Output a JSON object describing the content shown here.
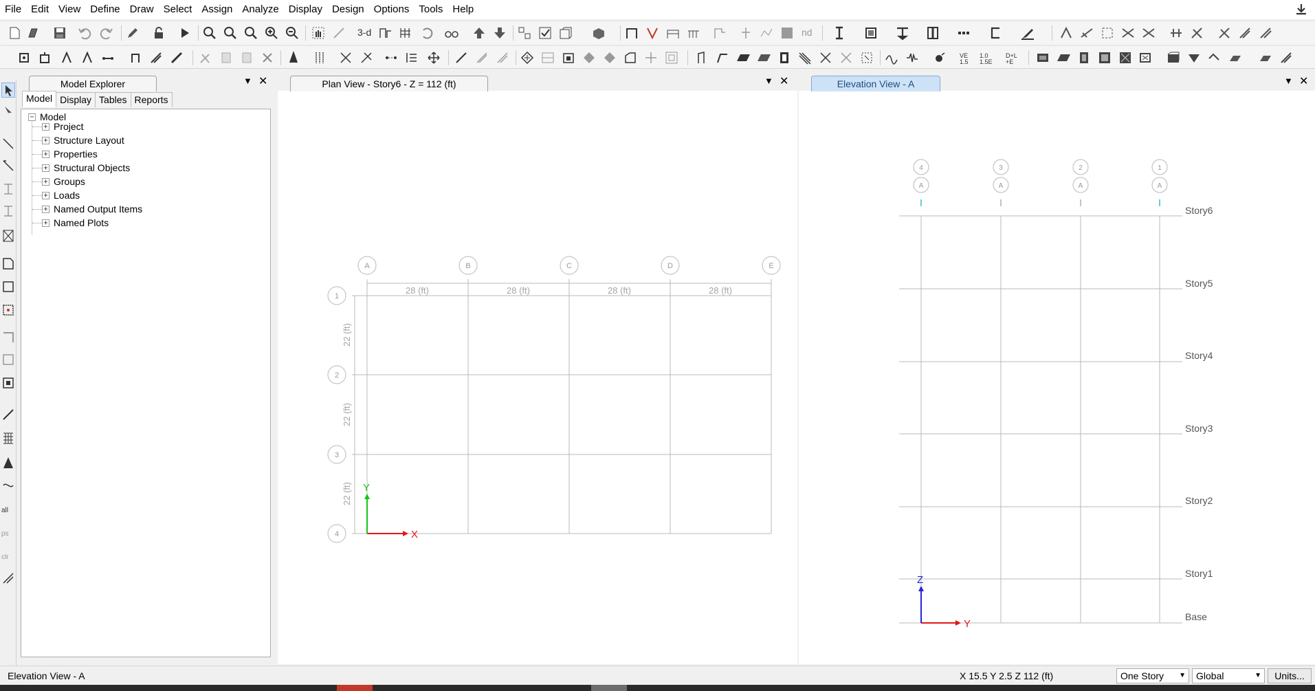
{
  "menu": [
    "File",
    "Edit",
    "View",
    "Define",
    "Draw",
    "Select",
    "Assign",
    "Analyze",
    "Display",
    "Design",
    "Options",
    "Tools",
    "Help"
  ],
  "toolbar": {
    "three_d": "3-d",
    "nd": "nd"
  },
  "explorer": {
    "title": "Model Explorer",
    "tabs": [
      "Model",
      "Display",
      "Tables",
      "Reports"
    ],
    "root": "Model",
    "items": [
      "Project",
      "Structure Layout",
      "Properties",
      "Structural Objects",
      "Groups",
      "Loads",
      "Named Output Items",
      "Named Plots"
    ]
  },
  "plan": {
    "title": "Plan View - Story6 - Z = 112 (ft)",
    "x_grids": [
      "A",
      "B",
      "C",
      "D",
      "E"
    ],
    "y_grids": [
      "1",
      "2",
      "3",
      "4"
    ],
    "x_spacing_label": "28 (ft)",
    "y_spacing_label": "22 (ft)",
    "axis_x": "X",
    "axis_y": "Y"
  },
  "elevation": {
    "title": "Elevation View - A",
    "grid_top": [
      "4",
      "3",
      "2",
      "1"
    ],
    "grid_bottom": [
      "A",
      "A",
      "A",
      "A"
    ],
    "stories": [
      "Story6",
      "Story5",
      "Story4",
      "Story3",
      "Story2",
      "Story1",
      "Base"
    ],
    "axis_z": "Z",
    "axis_y": "Y"
  },
  "status": {
    "left": "Elevation View - A",
    "coords": "X 15.5  Y 2.5  Z 112 (ft)",
    "story_select": "One Story",
    "coord_select": "Global",
    "units_button": "Units..."
  },
  "colors": {
    "grid": "#b9b9b9",
    "x_axis": "#e01818",
    "y_axis": "#18c418",
    "z_axis": "#2626d6",
    "tab_selected": "#cde2f7"
  }
}
